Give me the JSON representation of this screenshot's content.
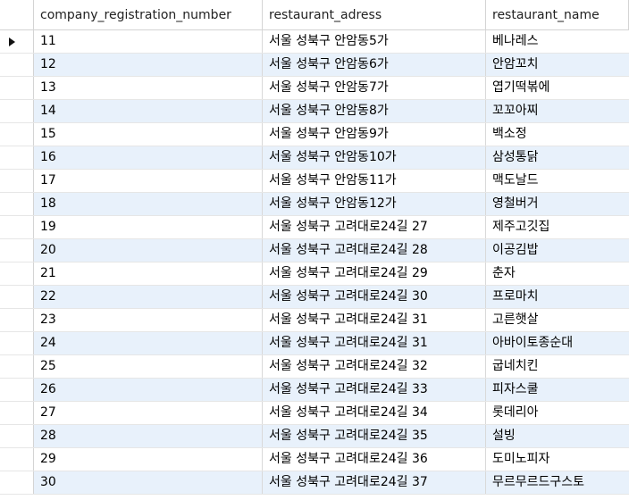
{
  "table": {
    "columns": [
      "company_registration_number",
      "restaurant_adress",
      "restaurant_name"
    ],
    "current_row": 0,
    "rows": [
      [
        "11",
        "서울 성북구 안암동5가",
        "베나레스"
      ],
      [
        "12",
        "서울 성북구 안암동6가",
        "안암꼬치"
      ],
      [
        "13",
        "서울 성북구 안암동7가",
        "엽기떡볶에"
      ],
      [
        "14",
        "서울 성북구 안암동8가",
        "꼬꼬아찌"
      ],
      [
        "15",
        "서울 성북구 안암동9가",
        "백소정"
      ],
      [
        "16",
        "서울 성북구 안암동10가",
        "삼성통닭"
      ],
      [
        "17",
        "서울 성북구 안암동11가",
        "맥도날드"
      ],
      [
        "18",
        "서울 성북구 안암동12가",
        "영철버거"
      ],
      [
        "19",
        "서울 성북구 고려대로24길 27",
        "제주고깃집"
      ],
      [
        "20",
        "서울 성북구 고려대로24길 28",
        "이공김밥"
      ],
      [
        "21",
        "서울 성북구 고려대로24길 29",
        "춘자"
      ],
      [
        "22",
        "서울 성북구 고려대로24길 30",
        "프로마치"
      ],
      [
        "23",
        "서울 성북구 고려대로24길 31",
        "고른햇살"
      ],
      [
        "24",
        "서울 성북구 고려대로24길 31",
        "아바이토종순대"
      ],
      [
        "25",
        "서울 성북구 고려대로24길 32",
        "굽네치킨"
      ],
      [
        "26",
        "서울 성북구 고려대로24길 33",
        "피자스쿨"
      ],
      [
        "27",
        "서울 성북구 고려대로24길 34",
        "롯데리아"
      ],
      [
        "28",
        "서울 성북구 고려대로24길 35",
        "설빙"
      ],
      [
        "29",
        "서울 성북구 고려대로24길 36",
        "도미노피자"
      ],
      [
        "30",
        "서울 성북구 고려대로24길 37",
        "무르무르드구스토"
      ]
    ]
  },
  "colors": {
    "alt_row": "#e8f1fb",
    "grid_line": "#d9d9d9"
  }
}
